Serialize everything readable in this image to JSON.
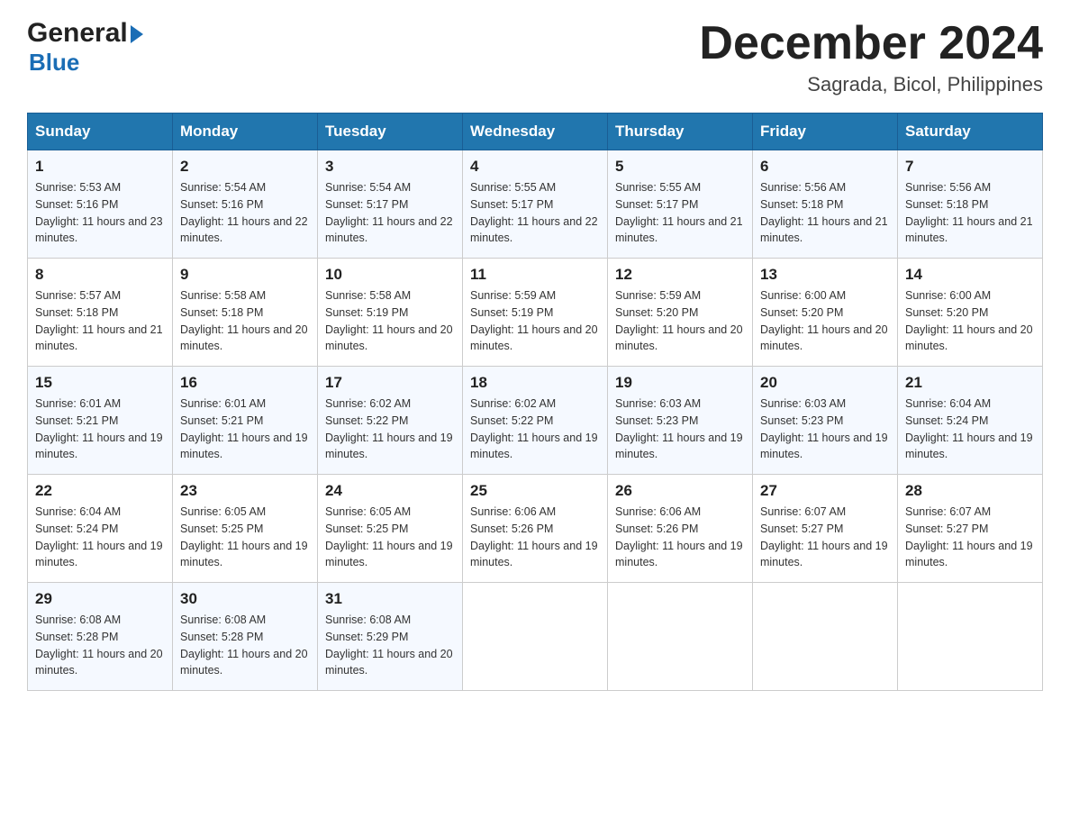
{
  "header": {
    "logo_general": "General",
    "logo_blue": "Blue",
    "month_title": "December 2024",
    "subtitle": "Sagrada, Bicol, Philippines"
  },
  "days_of_week": [
    "Sunday",
    "Monday",
    "Tuesday",
    "Wednesday",
    "Thursday",
    "Friday",
    "Saturday"
  ],
  "weeks": [
    [
      {
        "day": "1",
        "sunrise": "5:53 AM",
        "sunset": "5:16 PM",
        "daylight": "11 hours and 23 minutes."
      },
      {
        "day": "2",
        "sunrise": "5:54 AM",
        "sunset": "5:16 PM",
        "daylight": "11 hours and 22 minutes."
      },
      {
        "day": "3",
        "sunrise": "5:54 AM",
        "sunset": "5:17 PM",
        "daylight": "11 hours and 22 minutes."
      },
      {
        "day": "4",
        "sunrise": "5:55 AM",
        "sunset": "5:17 PM",
        "daylight": "11 hours and 22 minutes."
      },
      {
        "day": "5",
        "sunrise": "5:55 AM",
        "sunset": "5:17 PM",
        "daylight": "11 hours and 21 minutes."
      },
      {
        "day": "6",
        "sunrise": "5:56 AM",
        "sunset": "5:18 PM",
        "daylight": "11 hours and 21 minutes."
      },
      {
        "day": "7",
        "sunrise": "5:56 AM",
        "sunset": "5:18 PM",
        "daylight": "11 hours and 21 minutes."
      }
    ],
    [
      {
        "day": "8",
        "sunrise": "5:57 AM",
        "sunset": "5:18 PM",
        "daylight": "11 hours and 21 minutes."
      },
      {
        "day": "9",
        "sunrise": "5:58 AM",
        "sunset": "5:18 PM",
        "daylight": "11 hours and 20 minutes."
      },
      {
        "day": "10",
        "sunrise": "5:58 AM",
        "sunset": "5:19 PM",
        "daylight": "11 hours and 20 minutes."
      },
      {
        "day": "11",
        "sunrise": "5:59 AM",
        "sunset": "5:19 PM",
        "daylight": "11 hours and 20 minutes."
      },
      {
        "day": "12",
        "sunrise": "5:59 AM",
        "sunset": "5:20 PM",
        "daylight": "11 hours and 20 minutes."
      },
      {
        "day": "13",
        "sunrise": "6:00 AM",
        "sunset": "5:20 PM",
        "daylight": "11 hours and 20 minutes."
      },
      {
        "day": "14",
        "sunrise": "6:00 AM",
        "sunset": "5:20 PM",
        "daylight": "11 hours and 20 minutes."
      }
    ],
    [
      {
        "day": "15",
        "sunrise": "6:01 AM",
        "sunset": "5:21 PM",
        "daylight": "11 hours and 19 minutes."
      },
      {
        "day": "16",
        "sunrise": "6:01 AM",
        "sunset": "5:21 PM",
        "daylight": "11 hours and 19 minutes."
      },
      {
        "day": "17",
        "sunrise": "6:02 AM",
        "sunset": "5:22 PM",
        "daylight": "11 hours and 19 minutes."
      },
      {
        "day": "18",
        "sunrise": "6:02 AM",
        "sunset": "5:22 PM",
        "daylight": "11 hours and 19 minutes."
      },
      {
        "day": "19",
        "sunrise": "6:03 AM",
        "sunset": "5:23 PM",
        "daylight": "11 hours and 19 minutes."
      },
      {
        "day": "20",
        "sunrise": "6:03 AM",
        "sunset": "5:23 PM",
        "daylight": "11 hours and 19 minutes."
      },
      {
        "day": "21",
        "sunrise": "6:04 AM",
        "sunset": "5:24 PM",
        "daylight": "11 hours and 19 minutes."
      }
    ],
    [
      {
        "day": "22",
        "sunrise": "6:04 AM",
        "sunset": "5:24 PM",
        "daylight": "11 hours and 19 minutes."
      },
      {
        "day": "23",
        "sunrise": "6:05 AM",
        "sunset": "5:25 PM",
        "daylight": "11 hours and 19 minutes."
      },
      {
        "day": "24",
        "sunrise": "6:05 AM",
        "sunset": "5:25 PM",
        "daylight": "11 hours and 19 minutes."
      },
      {
        "day": "25",
        "sunrise": "6:06 AM",
        "sunset": "5:26 PM",
        "daylight": "11 hours and 19 minutes."
      },
      {
        "day": "26",
        "sunrise": "6:06 AM",
        "sunset": "5:26 PM",
        "daylight": "11 hours and 19 minutes."
      },
      {
        "day": "27",
        "sunrise": "6:07 AM",
        "sunset": "5:27 PM",
        "daylight": "11 hours and 19 minutes."
      },
      {
        "day": "28",
        "sunrise": "6:07 AM",
        "sunset": "5:27 PM",
        "daylight": "11 hours and 19 minutes."
      }
    ],
    [
      {
        "day": "29",
        "sunrise": "6:08 AM",
        "sunset": "5:28 PM",
        "daylight": "11 hours and 20 minutes."
      },
      {
        "day": "30",
        "sunrise": "6:08 AM",
        "sunset": "5:28 PM",
        "daylight": "11 hours and 20 minutes."
      },
      {
        "day": "31",
        "sunrise": "6:08 AM",
        "sunset": "5:29 PM",
        "daylight": "11 hours and 20 minutes."
      },
      null,
      null,
      null,
      null
    ]
  ]
}
